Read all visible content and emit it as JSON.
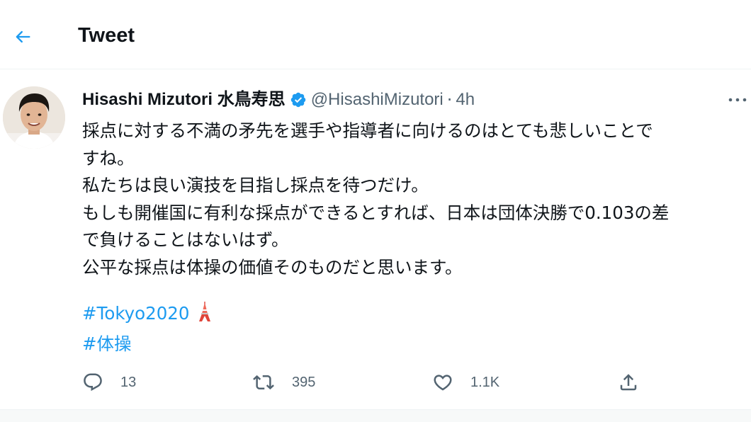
{
  "header": {
    "title": "Tweet",
    "back_icon": "arrow-left-icon"
  },
  "tweet": {
    "author_name": "Hisashi Mizutori 水鳥寿思",
    "handle": "@HisashiMizutori",
    "separator": "·",
    "time": "4h",
    "verified": true,
    "lines": [
      "採点に対する不満の矛先を選手や指導者に向けるのはとても悲しいことで",
      "すね。",
      "私たちは良い演技を目指し採点を待つだけ。",
      "もしも開催国に有利な採点ができるとすれば、日本は団体決勝で0.103の差",
      "で負けることはないはず。",
      "公平な採点は体操の価値そのものだと思います。"
    ],
    "hashtags": [
      {
        "text": "#Tokyo2020",
        "icon": "tokyo-tower-icon"
      },
      {
        "text": "#体操"
      }
    ]
  },
  "actions": {
    "reply": {
      "count": "13",
      "icon": "reply-icon"
    },
    "retweet": {
      "count": "395",
      "icon": "retweet-icon"
    },
    "like": {
      "count": "1.1K",
      "icon": "heart-icon"
    },
    "share": {
      "icon": "share-icon"
    }
  },
  "colors": {
    "accent": "#1d9bf0",
    "text": "#0f1419",
    "secondary": "#536471",
    "divider": "#eff3f4"
  }
}
